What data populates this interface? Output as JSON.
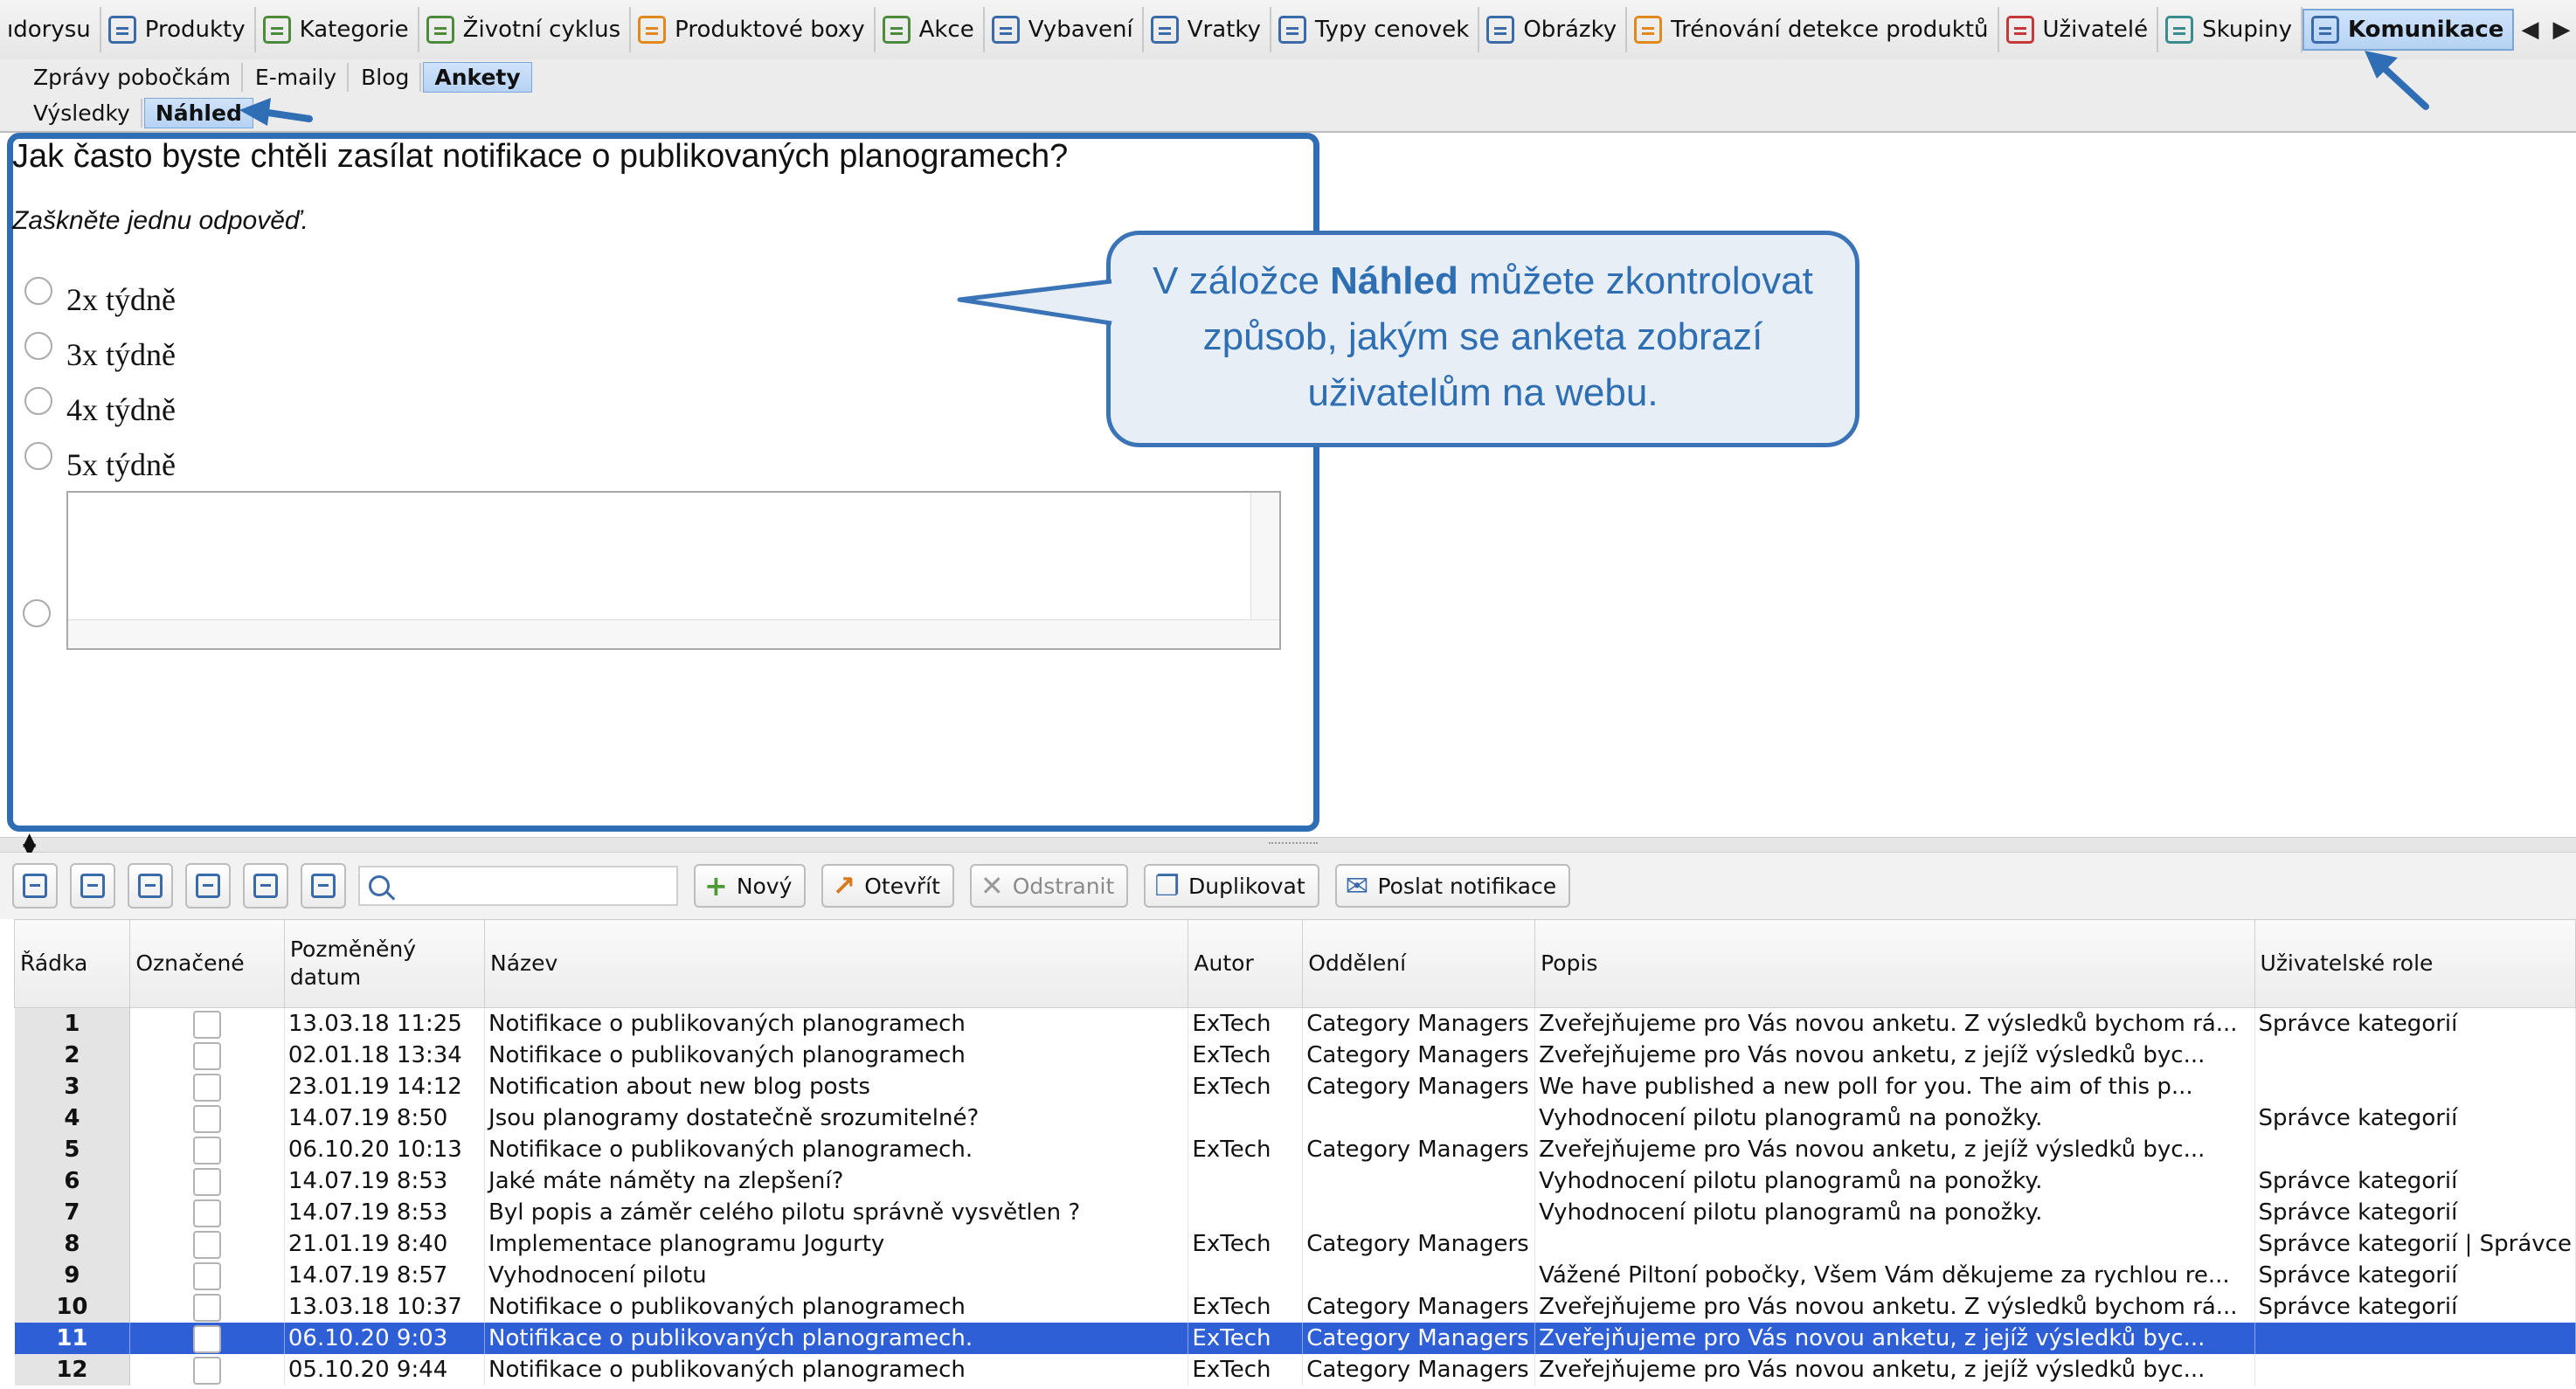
{
  "top_tabs": [
    {
      "label": "ıdorysu",
      "icon": "none"
    },
    {
      "label": "Produkty",
      "icon": "products-icon"
    },
    {
      "label": "Kategorie",
      "icon": "categories-icon"
    },
    {
      "label": "Životní cyklus",
      "icon": "lifecycle-icon"
    },
    {
      "label": "Produktové boxy",
      "icon": "product-box-icon"
    },
    {
      "label": "Akce",
      "icon": "promotion-icon"
    },
    {
      "label": "Vybavení",
      "icon": "equipment-icon"
    },
    {
      "label": "Vratky",
      "icon": "returns-icon"
    },
    {
      "label": "Typy cenovek",
      "icon": "price-tag-icon"
    },
    {
      "label": "Obrázky",
      "icon": "image-icon"
    },
    {
      "label": "Trénování detekce produktů",
      "icon": "training-icon"
    },
    {
      "label": "Uživatelé",
      "icon": "user-icon"
    },
    {
      "label": "Skupiny",
      "icon": "groups-icon"
    },
    {
      "label": "Komunikace",
      "icon": "mail-icon",
      "active": true
    }
  ],
  "sub_tabs": [
    "Zprávy pobočkám",
    "E-maily",
    "Blog",
    "Ankety"
  ],
  "sub_tabs_active": "Ankety",
  "sub_tabs2": [
    "Výsledky",
    "Náhled"
  ],
  "sub_tabs2_active": "Náhled",
  "preview": {
    "question": "Jak často byste chtěli zasílat notifikace o publikovaných planogramech?",
    "instruction": "Zaškněte jednu odpověď.",
    "options": [
      "2x týdně",
      "3x týdně",
      "4x týdně",
      "5x týdně"
    ]
  },
  "callout": {
    "text_before": "V záložce ",
    "text_bold": "Náhled",
    "text_after": " můžete zkontrolovat způsob, jakým se anketa zobrazí uživatelům na webu."
  },
  "toolbar": {
    "search_placeholder": "",
    "new_label": "Nový",
    "open_label": "Otevřít",
    "delete_label": "Odstranit",
    "duplicate_label": "Duplikovat",
    "notify_label": "Poslat notifikace"
  },
  "table": {
    "headers": [
      "Řádka",
      "Označené",
      "Pozměněný datum",
      "Název",
      "Autor",
      "Oddělení",
      "Popis",
      "Uživatelské role"
    ],
    "selected_row": 11,
    "rows": [
      {
        "n": "1",
        "date": "13.03.18 11:25",
        "name": "Notifikace o publikovaných planogramech",
        "author": "ExTech",
        "dept": "Category Managers",
        "desc": "Zveřejňujeme pro Vás novou anketu. Z výsledků bychom rá...",
        "roles": "Správce kategorií"
      },
      {
        "n": "2",
        "date": "02.01.18 13:34",
        "name": "Notifikace o publikovaných planogramech",
        "author": "ExTech",
        "dept": "Category Managers",
        "desc": "Zveřejňujeme pro Vás novou anketu, z jejíž výsledků byc...",
        "roles": ""
      },
      {
        "n": "3",
        "date": "23.01.19 14:12",
        "name": "Notification about new blog posts",
        "author": "ExTech",
        "dept": "Category Managers",
        "desc": "We have published a new poll for you. The aim of this p...",
        "roles": ""
      },
      {
        "n": "4",
        "date": "14.07.19 8:50",
        "name": "Jsou planogramy dostatečně srozumitelné?",
        "author": "",
        "dept": "",
        "desc": "Vyhodnocení pilotu planogramů na ponožky.",
        "roles": "Správce kategorií"
      },
      {
        "n": "5",
        "date": "06.10.20 10:13",
        "name": "Notifikace o publikovaných planogramech.",
        "author": "ExTech",
        "dept": "Category Managers",
        "desc": "Zveřejňujeme pro Vás novou anketu, z jejíž výsledků byc...",
        "roles": ""
      },
      {
        "n": "6",
        "date": "14.07.19 8:53",
        "name": "Jaké máte náměty na zlepšení?",
        "author": "",
        "dept": "",
        "desc": "Vyhodnocení pilotu planogramů na ponožky.",
        "roles": "Správce kategorií"
      },
      {
        "n": "7",
        "date": "14.07.19 8:53",
        "name": "Byl popis a záměr celého pilotu správně vysvětlen ?",
        "author": "",
        "dept": "",
        "desc": "Vyhodnocení pilotu planogramů na ponožky.",
        "roles": "Správce kategorií"
      },
      {
        "n": "8",
        "date": "21.01.19 8:40",
        "name": "Implementace planogramu Jogurty",
        "author": "ExTech",
        "dept": "Category Managers",
        "desc": "",
        "roles": "Správce kategorií | Správce"
      },
      {
        "n": "9",
        "date": "14.07.19 8:57",
        "name": "Vyhodnocení pilotu",
        "author": "",
        "dept": "",
        "desc": "Vážené Piltoní pobočky, Všem Vám děkujeme za rychlou re...",
        "roles": "Správce kategorií"
      },
      {
        "n": "10",
        "date": "13.03.18 10:37",
        "name": "Notifikace o publikovaných planogramech",
        "author": "ExTech",
        "dept": "Category Managers",
        "desc": "Zveřejňujeme pro Vás novou anketu. Z výsledků bychom rá...",
        "roles": "Správce kategorií"
      },
      {
        "n": "11",
        "date": "06.10.20 9:03",
        "name": "Notifikace o publikovaných planogramech.",
        "author": "ExTech",
        "dept": "Category Managers",
        "desc": "Zveřejňujeme pro Vás novou anketu, z jejíž výsledků byc...",
        "roles": ""
      },
      {
        "n": "12",
        "date": "05.10.20 9:44",
        "name": "Notifikace o publikovaných planogramech",
        "author": "ExTech",
        "dept": "Category Managers",
        "desc": "Zveřejňujeme pro Vás novou anketu, z jejíž výsledků byc...",
        "roles": ""
      }
    ]
  },
  "colors": {
    "accent": "#2f6db5",
    "selection": "#2f5fd7",
    "callout_text": "#2e6fb4"
  }
}
